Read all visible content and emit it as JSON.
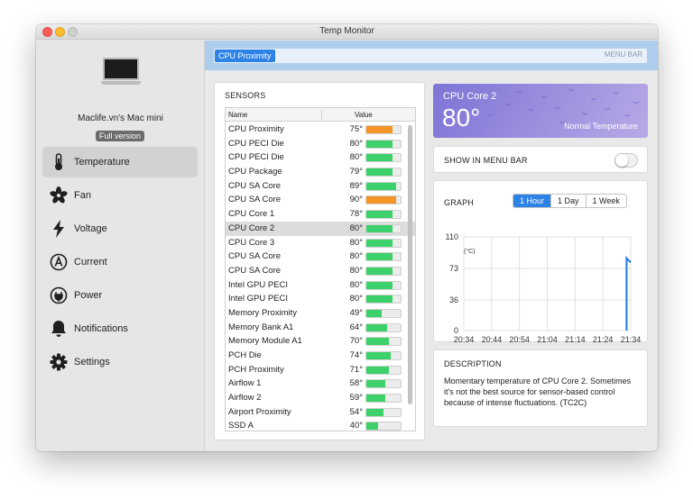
{
  "window": {
    "title": "Temp Monitor"
  },
  "sidebar": {
    "device_name": "Maclife.vn's Mac mini",
    "license_badge": "Full version",
    "items": [
      {
        "label": "Temperature",
        "icon": "thermometer-icon",
        "active": true
      },
      {
        "label": "Fan",
        "icon": "fan-icon",
        "active": false
      },
      {
        "label": "Voltage",
        "icon": "lightning-icon",
        "active": false
      },
      {
        "label": "Current",
        "icon": "ampere-icon",
        "active": false
      },
      {
        "label": "Power",
        "icon": "power-plug-icon",
        "active": false
      },
      {
        "label": "Notifications",
        "icon": "bell-icon",
        "active": false
      },
      {
        "label": "Settings",
        "icon": "gear-icon",
        "active": false
      }
    ]
  },
  "menubar_preview": {
    "item": "CPU Proximity",
    "label": "MENU BAR"
  },
  "sensors": {
    "title": "SENSORS",
    "col_name": "Name",
    "col_value": "Value",
    "rows": [
      {
        "name": "CPU Proximity",
        "value": "75°",
        "level": 0.75,
        "color": "#f59527"
      },
      {
        "name": "CPU PECI Die",
        "value": "80°",
        "level": 0.76,
        "color": "#3dd16b"
      },
      {
        "name": "CPU PECI Die",
        "value": "80°",
        "level": 0.76,
        "color": "#3dd16b"
      },
      {
        "name": "CPU Package",
        "value": "79°",
        "level": 0.76,
        "color": "#3dd16b"
      },
      {
        "name": "CPU SA Core",
        "value": "89°",
        "level": 0.86,
        "color": "#3dd16b"
      },
      {
        "name": "CPU SA Core",
        "value": "90°",
        "level": 0.88,
        "color": "#f59527"
      },
      {
        "name": "CPU Core 1",
        "value": "78°",
        "level": 0.75,
        "color": "#3dd16b"
      },
      {
        "name": "CPU Core 2",
        "value": "80°",
        "level": 0.76,
        "color": "#3dd16b",
        "selected": true
      },
      {
        "name": "CPU Core 3",
        "value": "80°",
        "level": 0.76,
        "color": "#3dd16b"
      },
      {
        "name": "CPU SA Core",
        "value": "80°",
        "level": 0.76,
        "color": "#3dd16b"
      },
      {
        "name": "CPU SA Core",
        "value": "80°",
        "level": 0.76,
        "color": "#3dd16b"
      },
      {
        "name": "Intel GPU PECI",
        "value": "80°",
        "level": 0.76,
        "color": "#3dd16b"
      },
      {
        "name": "Intel GPU PECI",
        "value": "80°",
        "level": 0.76,
        "color": "#3dd16b"
      },
      {
        "name": "Memory Proximity",
        "value": "49°",
        "level": 0.45,
        "color": "#3dd16b"
      },
      {
        "name": "Memory Bank A1",
        "value": "64°",
        "level": 0.6,
        "color": "#3dd16b"
      },
      {
        "name": "Memory Module A1",
        "value": "70°",
        "level": 0.66,
        "color": "#3dd16b"
      },
      {
        "name": "PCH Die",
        "value": "74°",
        "level": 0.7,
        "color": "#3dd16b"
      },
      {
        "name": "PCH Proximity",
        "value": "71°",
        "level": 0.67,
        "color": "#3dd16b"
      },
      {
        "name": "Airflow 1",
        "value": "58°",
        "level": 0.55,
        "color": "#3dd16b"
      },
      {
        "name": "Airflow 2",
        "value": "59°",
        "level": 0.56,
        "color": "#3dd16b"
      },
      {
        "name": "Airport Proximity",
        "value": "54°",
        "level": 0.5,
        "color": "#3dd16b"
      },
      {
        "name": "SSD A",
        "value": "40°",
        "level": 0.35,
        "color": "#3dd16b"
      }
    ]
  },
  "detail": {
    "sensor_name": "CPU Core 2",
    "temperature": "80°",
    "status": "Normal Temperature",
    "show_in_menu_bar_label": "SHOW IN MENU BAR",
    "show_in_menu_bar": false
  },
  "graph": {
    "title": "GRAPH",
    "ranges": [
      {
        "label": "1 Hour",
        "selected": true
      },
      {
        "label": "1 Day",
        "selected": false
      },
      {
        "label": "1 Week",
        "selected": false
      }
    ],
    "accent_color": "#2d82e6"
  },
  "description": {
    "title": "DESCRIPTION",
    "text": "Momentary temperature of CPU Core 2. Sometimes it's not the best source for sensor-based control because of intense fluctuations. (TC2C)"
  },
  "chart_data": {
    "type": "line",
    "title": "",
    "xlabel": "",
    "ylabel": "(°C)",
    "x_ticks": [
      "20:34",
      "20:44",
      "20:54",
      "21:04",
      "21:14",
      "21:24",
      "21:34"
    ],
    "y_ticks": [
      0,
      36,
      73,
      110
    ],
    "ylim": [
      0,
      110
    ],
    "grid": true,
    "series": [
      {
        "x": [
          "21:33",
          "21:33",
          "21:34"
        ],
        "values": [
          0,
          85,
          80
        ]
      }
    ]
  }
}
